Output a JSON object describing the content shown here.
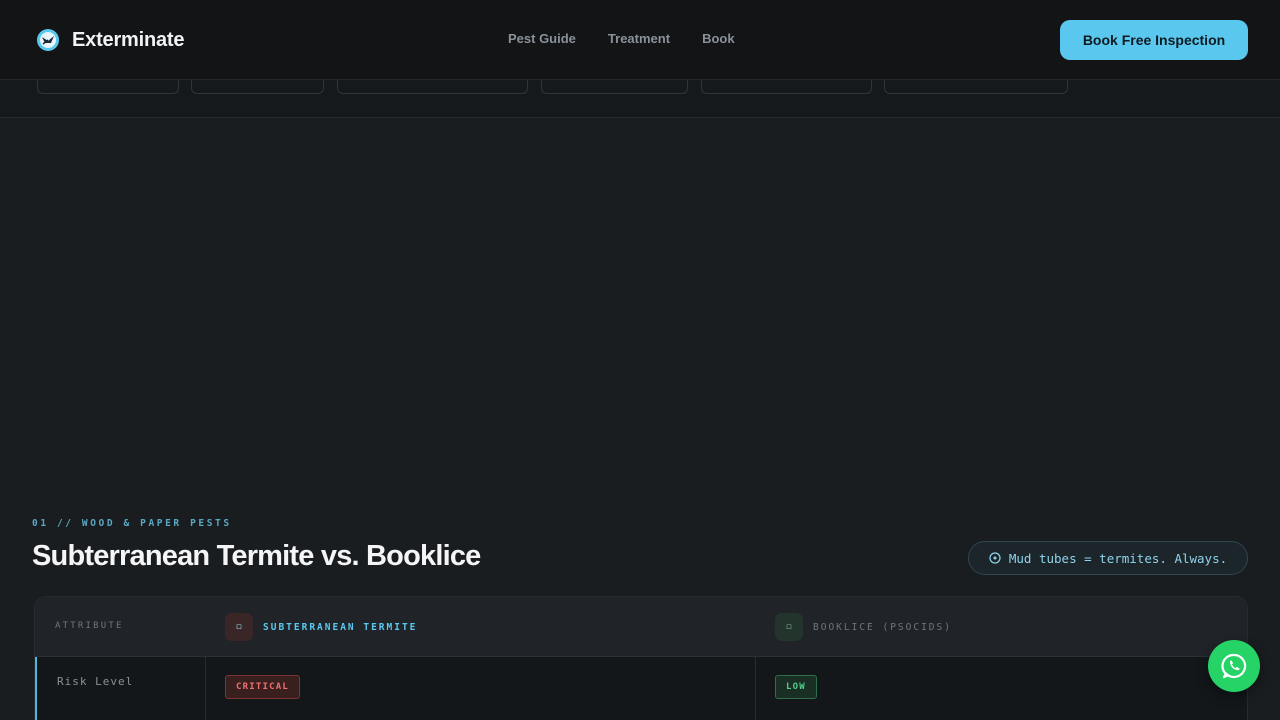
{
  "header": {
    "brand": "Exterminate",
    "nav": [
      "Pest Guide",
      "Treatment",
      "Book"
    ],
    "cta": "Book Free Inspection"
  },
  "section": {
    "eyebrow": "01 // WOOD & PAPER PESTS",
    "title": "Subterranean Termite vs. Booklice",
    "tip": "Mud tubes = termites. Always."
  },
  "table": {
    "attribute_header": "ATTRIBUTE",
    "columns": [
      {
        "label": "SUBTERRANEAN TERMITE",
        "icon": "termite-icon"
      },
      {
        "label": "BOOKLICE (PSOCIDS)",
        "icon": "booklice-icon"
      }
    ],
    "rows": [
      {
        "label": "Risk Level",
        "values": [
          "CRITICAL",
          "LOW"
        ]
      }
    ]
  },
  "colors": {
    "accent": "#5ac8ee",
    "critical": "#f07070",
    "low": "#4fd08a",
    "whatsapp": "#25d366"
  },
  "icons": {
    "logo": "bug-logo-icon",
    "tip": "info-circle-icon",
    "fab": "whatsapp-icon"
  }
}
